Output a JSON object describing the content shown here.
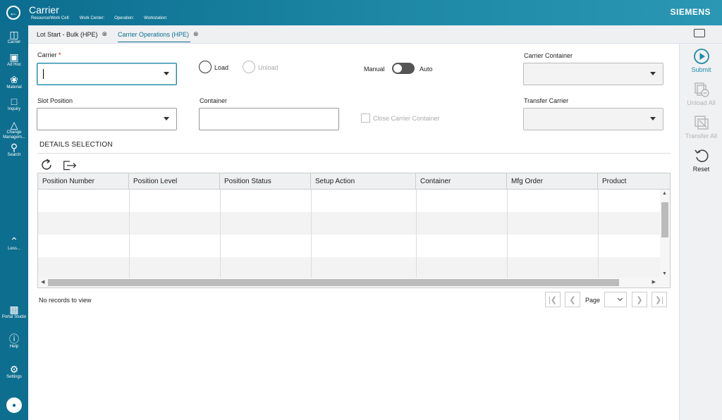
{
  "header": {
    "title": "Carrier",
    "sub": [
      "Resource/Work Cell:",
      "Work Center:",
      "Operation:",
      "Workstation:"
    ],
    "brand": "SIEMENS"
  },
  "rail": {
    "items": [
      {
        "label": "Carrier",
        "icon": "carrier-icon"
      },
      {
        "label": "Ad Hoc",
        "icon": "adhoc-icon"
      },
      {
        "label": "Material",
        "icon": "material-icon"
      },
      {
        "label": "Inquiry",
        "icon": "inquiry-icon"
      },
      {
        "label": "Change Managem...",
        "icon": "change-icon"
      },
      {
        "label": "Search",
        "icon": "search-icon"
      },
      {
        "label": "Less...",
        "icon": "chevron-up-icon"
      },
      {
        "label": "Portal Studio",
        "icon": "portal-icon"
      },
      {
        "label": "Help",
        "icon": "help-icon"
      },
      {
        "label": "Settings",
        "icon": "gear-icon"
      }
    ]
  },
  "tabs": [
    {
      "label": "Lot Start - Bulk (HPE)"
    },
    {
      "label": "Carrier Operations (HPE)"
    }
  ],
  "form": {
    "carrier_label": "Carrier",
    "required_mark": "*",
    "load_label": "Load",
    "unload_label": "Unload",
    "manual_label": "Manual",
    "auto_label": "Auto",
    "carrier_container_label": "Carrier Container",
    "slot_position_label": "Slot Position",
    "container_label": "Container",
    "close_carrier_container_label": "Close Carrier Container",
    "transfer_carrier_label": "Transfer Carrier"
  },
  "details": {
    "title": "DETAILS SELECTION",
    "columns": [
      "Position Number",
      "Position Level",
      "Position Status",
      "Setup Action",
      "Container",
      "Mfg Order",
      "Product"
    ],
    "empty_text": "No records to view",
    "page_label": "Page"
  },
  "actions": [
    {
      "label": "Submit",
      "icon": "play-circle-icon",
      "enabled": true
    },
    {
      "label": "Unload All",
      "icon": "unload-all-icon",
      "enabled": false
    },
    {
      "label": "Transfer All",
      "icon": "transfer-all-icon",
      "enabled": false
    },
    {
      "label": "Reset",
      "icon": "reset-icon",
      "enabled": true
    }
  ],
  "colors": {
    "header": "#0e6e8f",
    "accent": "#1f8aa8"
  }
}
